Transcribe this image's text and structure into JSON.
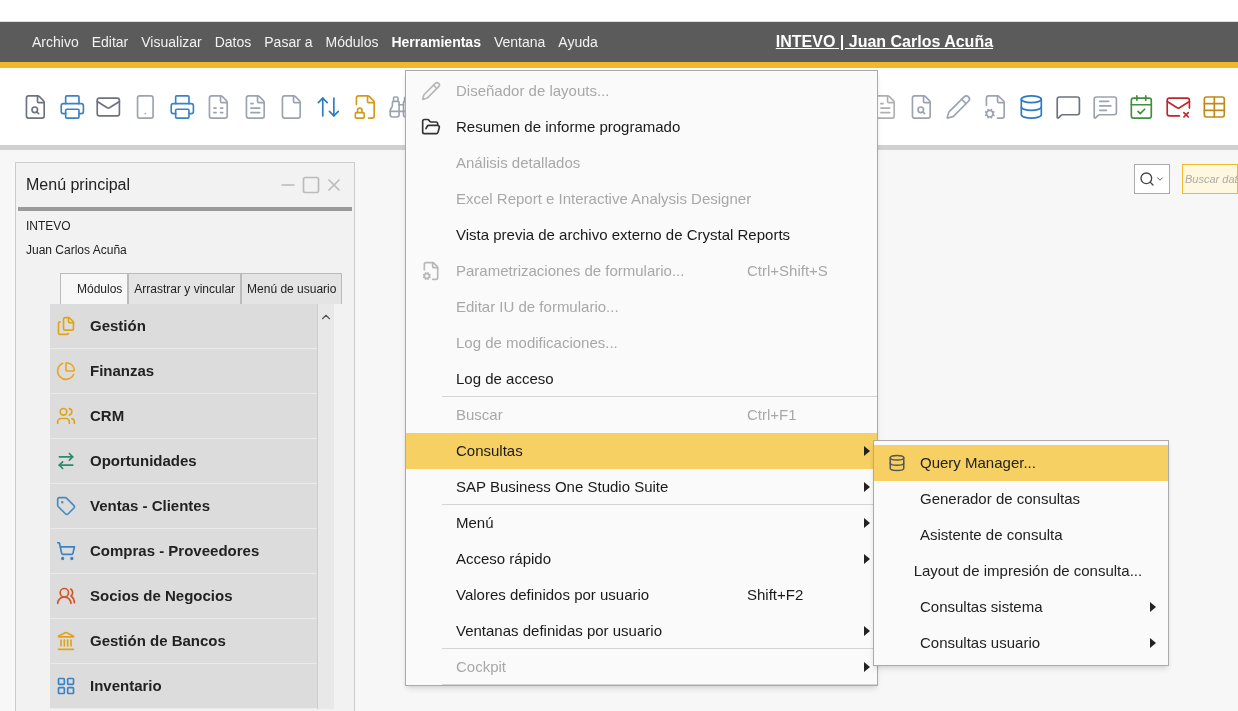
{
  "menubar": {
    "items": [
      {
        "label": "Archivo",
        "selected": false
      },
      {
        "label": "Editar",
        "selected": false
      },
      {
        "label": "Visualizar",
        "selected": false
      },
      {
        "label": "Datos",
        "selected": false
      },
      {
        "label": "Pasar a",
        "selected": false
      },
      {
        "label": "Módulos",
        "selected": false
      },
      {
        "label": "Herramientas",
        "selected": true
      },
      {
        "label": "Ventana",
        "selected": false
      },
      {
        "label": "Ayuda",
        "selected": false
      }
    ],
    "title": "INTEVO | Juan Carlos Acuña"
  },
  "search": {
    "placeholder": "Buscar dat"
  },
  "main_menu": {
    "title": "Menú principal",
    "company": "INTEVO",
    "user": "Juan Carlos Acuña",
    "tabs": [
      {
        "label": "Módulos",
        "selected": true
      },
      {
        "label": "Arrastrar y vincular",
        "selected": false
      },
      {
        "label": "Menú de usuario",
        "selected": false
      }
    ],
    "modules": [
      "Gestión",
      "Finanzas",
      "CRM",
      "Oportunidades",
      "Ventas - Clientes",
      "Compras - Proveedores",
      "Socios de Negocios",
      "Gestión de Bancos",
      "Inventario"
    ]
  },
  "tools_menu": {
    "items": [
      {
        "label": "Diseñador de layouts...",
        "disabled": true,
        "selected": false,
        "submenu": false,
        "separator_after": false
      },
      {
        "label": "Resumen de informe programado",
        "disabled": false,
        "selected": false,
        "submenu": false,
        "separator_after": false
      },
      {
        "label": "Análisis detallados",
        "disabled": true,
        "selected": false,
        "submenu": false,
        "separator_after": false
      },
      {
        "label": "Excel Report e Interactive Analysis Designer",
        "disabled": true,
        "selected": false,
        "submenu": false,
        "separator_after": false
      },
      {
        "label": "Vista previa de archivo externo de Crystal Reports",
        "disabled": false,
        "selected": false,
        "submenu": false,
        "separator_after": false
      },
      {
        "label": "Parametrizaciones de formulario...",
        "shortcut": "Ctrl+Shift+S",
        "disabled": true,
        "selected": false,
        "submenu": false,
        "separator_after": false
      },
      {
        "label": "Editar IU de formulario...",
        "disabled": true,
        "selected": false,
        "submenu": false,
        "separator_after": false
      },
      {
        "label": "Log de modificaciones...",
        "disabled": true,
        "selected": false,
        "submenu": false,
        "separator_after": false
      },
      {
        "label": "Log de acceso",
        "disabled": false,
        "selected": false,
        "submenu": false,
        "separator_after": true
      },
      {
        "label": "Buscar",
        "shortcut": "Ctrl+F1",
        "disabled": true,
        "selected": false,
        "submenu": false,
        "separator_after": false
      },
      {
        "label": "Consultas",
        "disabled": false,
        "selected": true,
        "submenu": true,
        "separator_after": false
      },
      {
        "label": "SAP Business One Studio Suite",
        "disabled": false,
        "selected": false,
        "submenu": true,
        "separator_after": true
      },
      {
        "label": "Menú",
        "disabled": false,
        "selected": false,
        "submenu": true,
        "separator_after": false
      },
      {
        "label": "Acceso rápido",
        "disabled": false,
        "selected": false,
        "submenu": true,
        "separator_after": false
      },
      {
        "label": "Valores definidos por usuario",
        "shortcut": "Shift+F2",
        "disabled": false,
        "selected": false,
        "submenu": false,
        "separator_after": false
      },
      {
        "label": "Ventanas definidas por usuario",
        "disabled": false,
        "selected": false,
        "submenu": true,
        "separator_after": true
      },
      {
        "label": "Cockpit",
        "disabled": true,
        "selected": false,
        "submenu": true,
        "separator_after": true
      }
    ]
  },
  "queries_menu": {
    "items": [
      {
        "label": "Query Manager...",
        "selected": true,
        "submenu": false
      },
      {
        "label": "Generador de consultas",
        "selected": false,
        "submenu": false
      },
      {
        "label": "Asistente de consulta",
        "selected": false,
        "submenu": false
      },
      {
        "label": "Layout de impresión de consulta...",
        "selected": false,
        "submenu": false
      },
      {
        "label": "Consultas sistema",
        "selected": false,
        "submenu": true
      },
      {
        "label": "Consultas usuario",
        "selected": false,
        "submenu": true
      }
    ]
  }
}
